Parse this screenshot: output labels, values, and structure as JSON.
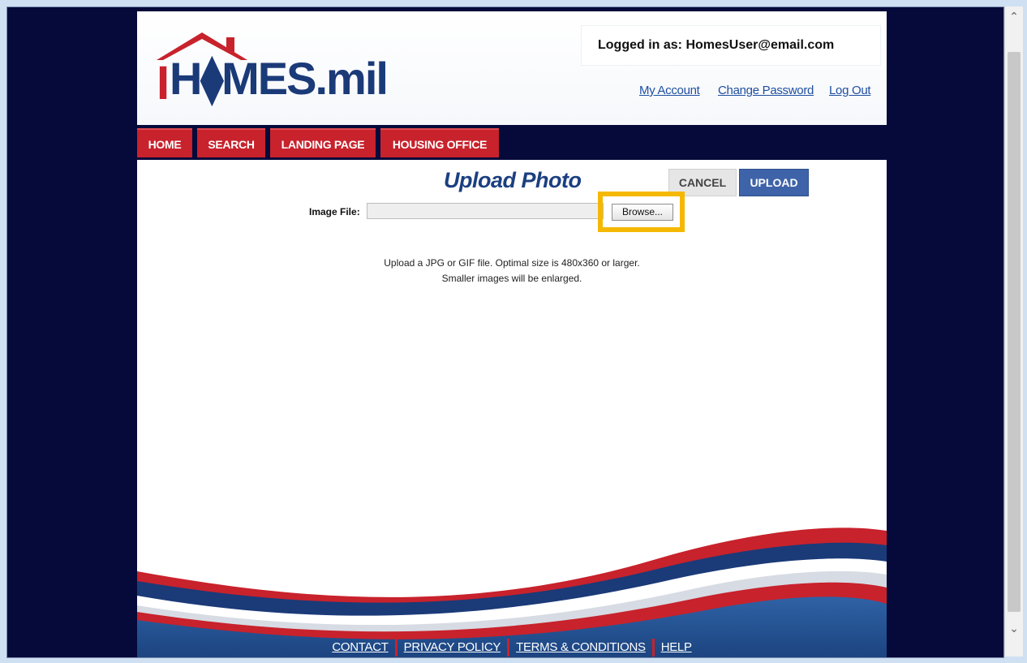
{
  "header": {
    "logo_text": "H⧫MES.mil",
    "login_text": "Logged in as:  HomesUser@email.com",
    "links": [
      "My Account",
      "Change Password",
      "Log Out"
    ]
  },
  "nav": {
    "tabs": [
      "HOME",
      "SEARCH",
      "LANDING PAGE",
      "HOUSING OFFICE"
    ]
  },
  "main": {
    "title": "Upload Photo",
    "cancel_label": "CANCEL",
    "upload_label": "UPLOAD",
    "image_file_label": "Image File:",
    "image_file_value": "",
    "browse_label": "Browse...",
    "help_line1": "Upload a JPG or GIF file. Optimal size is 480x360 or larger.",
    "help_line2": "Smaller images will be enlarged."
  },
  "footer": {
    "links": [
      "CONTACT",
      "PRIVACY POLICY",
      "TERMS & CONDITIONS",
      "HELP"
    ]
  },
  "colors": {
    "navy": "#050a3a",
    "brand_red": "#c8222c",
    "title_blue": "#1b3f80",
    "upload_button": "#3e63a8",
    "highlight": "#f5b800"
  },
  "icons": [
    "house-roof-icon",
    "globe-icon",
    "scroll-up-icon",
    "scroll-down-icon"
  ]
}
